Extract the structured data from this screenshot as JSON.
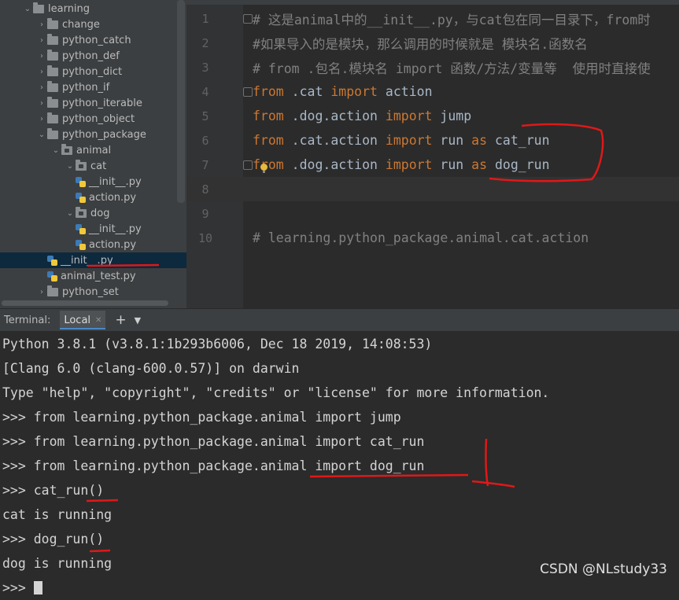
{
  "tree": {
    "items": [
      {
        "label": "learning",
        "type": "folder",
        "expanded": true
      },
      {
        "label": "change",
        "type": "folder"
      },
      {
        "label": "python_catch",
        "type": "folder"
      },
      {
        "label": "python_def",
        "type": "folder"
      },
      {
        "label": "python_dict",
        "type": "folder"
      },
      {
        "label": "python_if",
        "type": "folder"
      },
      {
        "label": "python_iterable",
        "type": "folder"
      },
      {
        "label": "python_object",
        "type": "folder"
      },
      {
        "label": "python_package",
        "type": "folder",
        "expanded": true
      },
      {
        "label": "animal",
        "type": "package",
        "expanded": true
      },
      {
        "label": "cat",
        "type": "package",
        "expanded": true
      },
      {
        "label": "__init__.py",
        "type": "file"
      },
      {
        "label": "action.py",
        "type": "file"
      },
      {
        "label": "dog",
        "type": "package",
        "expanded": true
      },
      {
        "label": "__init__.py",
        "type": "file"
      },
      {
        "label": "action.py",
        "type": "file"
      },
      {
        "label": "__init__.py",
        "type": "file",
        "selected": true
      },
      {
        "label": "animal_test.py",
        "type": "file"
      },
      {
        "label": "python_set",
        "type": "folder"
      }
    ]
  },
  "editor": {
    "lines": [
      {
        "num": "1",
        "segments": [
          {
            "t": "# 这是animal中的__init__.py，与cat包在同一目录下，from时",
            "c": "com"
          }
        ]
      },
      {
        "num": "2",
        "segments": [
          {
            "t": "#如果导入的是模块，那么调用的时候就是 模块名.函数名",
            "c": "com"
          }
        ]
      },
      {
        "num": "3",
        "segments": [
          {
            "t": "# from .包名.模块名 import 函数/方法/变量等  使用时直接使",
            "c": "com"
          }
        ]
      },
      {
        "num": "4",
        "segments": [
          {
            "t": "from",
            "c": "kw"
          },
          {
            "t": " .cat ",
            "c": "txt"
          },
          {
            "t": "import",
            "c": "kw"
          },
          {
            "t": " action",
            "c": "txt"
          }
        ]
      },
      {
        "num": "5",
        "segments": [
          {
            "t": "from",
            "c": "kw"
          },
          {
            "t": " .dog.action ",
            "c": "txt"
          },
          {
            "t": "import",
            "c": "kw"
          },
          {
            "t": " jump",
            "c": "txt"
          }
        ]
      },
      {
        "num": "6",
        "segments": [
          {
            "t": "from",
            "c": "kw"
          },
          {
            "t": " .cat.action ",
            "c": "txt"
          },
          {
            "t": "import",
            "c": "kw"
          },
          {
            "t": " run ",
            "c": "txt"
          },
          {
            "t": "as",
            "c": "kw"
          },
          {
            "t": " cat_run",
            "c": "txt"
          }
        ]
      },
      {
        "num": "7",
        "segments": [
          {
            "t": "from",
            "c": "kw"
          },
          {
            "t": " .dog.action ",
            "c": "txt"
          },
          {
            "t": "import",
            "c": "kw"
          },
          {
            "t": " run ",
            "c": "txt"
          },
          {
            "t": "as",
            "c": "kw"
          },
          {
            "t": " dog_run",
            "c": "txt"
          }
        ]
      },
      {
        "num": "8",
        "segments": []
      },
      {
        "num": "9",
        "segments": []
      },
      {
        "num": "10",
        "segments": [
          {
            "t": "# learning.python_package.animal.cat.action",
            "c": "com"
          }
        ]
      }
    ]
  },
  "terminal": {
    "label": "Terminal:",
    "tab": "Local",
    "lines": [
      "Python 3.8.1 (v3.8.1:1b293b6006, Dec 18 2019, 14:08:53)",
      "[Clang 6.0 (clang-600.0.57)] on darwin",
      "Type \"help\", \"copyright\", \"credits\" or \"license\" for more information.",
      ">>> from learning.python_package.animal import jump",
      ">>> from learning.python_package.animal import cat_run",
      ">>> from learning.python_package.animal import dog_run",
      ">>> cat_run()",
      "cat is running",
      ">>> dog_run()",
      "dog is running",
      ">>> "
    ]
  },
  "watermark": "CSDN @NLstudy33",
  "colors": {
    "keyword": "#cc7832",
    "comment": "#808080",
    "text": "#a9b7c6",
    "annotation": "#e01818"
  }
}
